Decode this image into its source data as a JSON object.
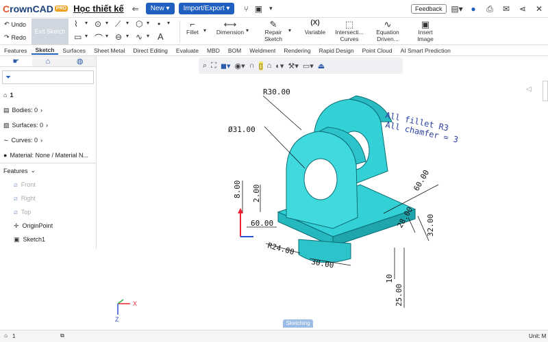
{
  "app": {
    "logo_prefix": "C",
    "logo_rest": "rownCAD",
    "pro_badge": "PRO",
    "doc_name": "Học thiết kế"
  },
  "topbar": {
    "new_label": "New ▾",
    "import_export_label": "Import/Export ▾",
    "feedback_label": "Feedback"
  },
  "ribbon": {
    "undo_label": "Undo",
    "redo_label": "Redo",
    "exit_sketch_label": "Exit Sketch",
    "fillet_label": "Fillet",
    "dimension_label": "Dimension",
    "repair_sketch_label": "Repair Sketch",
    "variable_label": "Variable",
    "variable_icon_text": "(X)",
    "intersection_curves_label": "Intersecti... Curves",
    "equation_driven_label": "Equation Driven...",
    "insert_image_label": "Insert Image"
  },
  "tabs": [
    "Features",
    "Sketch",
    "Surfaces",
    "Sheet Metal",
    "Direct Editing",
    "Evaluate",
    "MBD",
    "BOM",
    "Weldment",
    "Rendering",
    "Rapid Design",
    "Point Cloud",
    "AI Smart Prediction"
  ],
  "active_tab": "Sketch",
  "sidebar": {
    "part_count": "1",
    "bodies": "Bodies: 0",
    "surfaces": "Surfaces: 0",
    "curves": "Curves: 0",
    "material": "Material: None / Material N...",
    "features_header": "Features",
    "features": [
      {
        "label": "Front",
        "dim": true
      },
      {
        "label": "Right",
        "dim": true
      },
      {
        "label": "Top",
        "dim": true
      },
      {
        "label": "OriginPoint",
        "dim": false
      },
      {
        "label": "Sketch1",
        "dim": false
      }
    ]
  },
  "viewport": {
    "status_tab": "Sketching",
    "dims": {
      "r30": "R30.00",
      "d31": "Ø31.00",
      "d8": "8.00",
      "d2": "2.00",
      "d60a": "60.00",
      "r24": "R24.00",
      "d30": "30.00",
      "d60b": "60.00",
      "d28": "28.00",
      "d32": "32.00",
      "d10": "10",
      "d25": "25.00"
    },
    "note_line1": "All fillet R3",
    "note_line2": "All chamfer = 3",
    "axis_x": "X",
    "axis_z": "Z"
  },
  "bottom": {
    "instance_count": "1",
    "unit_label": "Unit: M"
  },
  "colors": {
    "brand_blue": "#1f5fbf",
    "model_cyan": "#33d1d6",
    "model_edge": "#0b6d74"
  }
}
